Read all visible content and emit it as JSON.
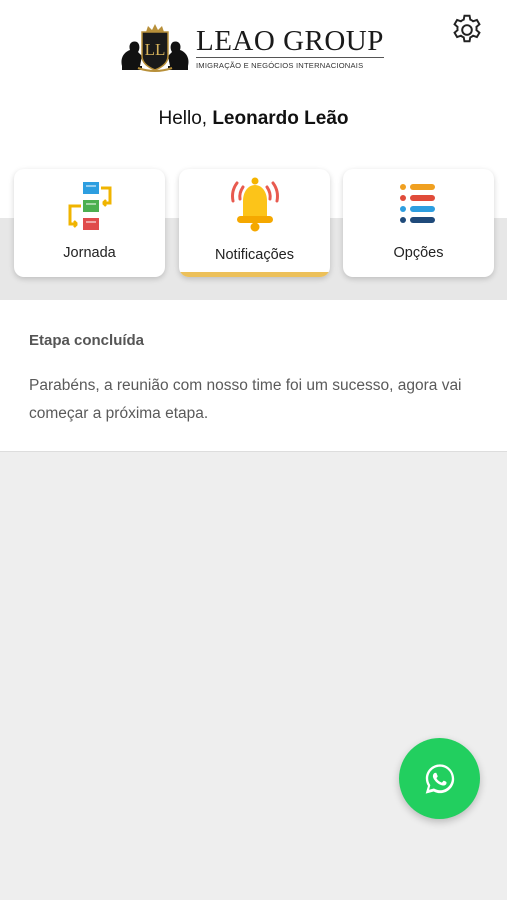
{
  "header": {
    "logo": {
      "monogram": "LL",
      "title": "LEAO GROUP",
      "subtitle": "IMIGRAÇÃO E NEGÓCIOS INTERNACIONAIS"
    },
    "settings_icon": "gear-icon",
    "greeting_prefix": "Hello, ",
    "user_name": "Leonardo Leão"
  },
  "cards": [
    {
      "label": "Jornada",
      "icon": "flowchart-icon",
      "active": false
    },
    {
      "label": "Notificações",
      "icon": "bell-icon",
      "active": true
    },
    {
      "label": "Opções",
      "icon": "list-icon",
      "active": false
    }
  ],
  "notification": {
    "title": "Etapa concluída",
    "body": "Parabéns, a reunião com nosso time foi um sucesso, agora vai começar a próxima etapa."
  },
  "fab": {
    "icon": "whatsapp-icon"
  },
  "colors": {
    "accent": "#ecc05a",
    "whatsapp": "#22cf5f",
    "background": "#eeeeee"
  }
}
